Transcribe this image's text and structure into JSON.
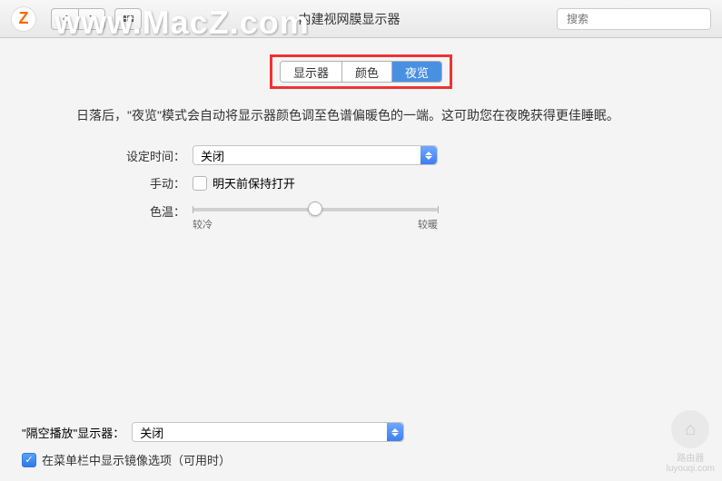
{
  "watermark": "www.MacZ.com",
  "titlebar": {
    "logo_letter": "Z",
    "title": "内建视网膜显示器",
    "search_placeholder": "搜索"
  },
  "tabs": {
    "display": "显示器",
    "color": "颜色",
    "night_shift": "夜览"
  },
  "description": "日落后，\"夜览\"模式会自动将显示器颜色调至色谱偏暖色的一端。这可助您在夜晚获得更佳睡眠。",
  "form": {
    "schedule_label": "设定时间：",
    "schedule_value": "关闭",
    "manual_label": "手动：",
    "manual_checkbox_label": "明天前保持打开",
    "manual_checked": false,
    "temperature_label": "色温：",
    "temperature_min": "较冷",
    "temperature_max": "较暖",
    "temperature_percent": 50
  },
  "airplay": {
    "label": "\"隔空播放\"显示器：",
    "value": "关闭"
  },
  "mirror": {
    "checked": true,
    "label": "在菜单栏中显示镜像选项（可用时）"
  },
  "corner_badge": {
    "text": "路由器",
    "sub": "luyouqi.com"
  }
}
